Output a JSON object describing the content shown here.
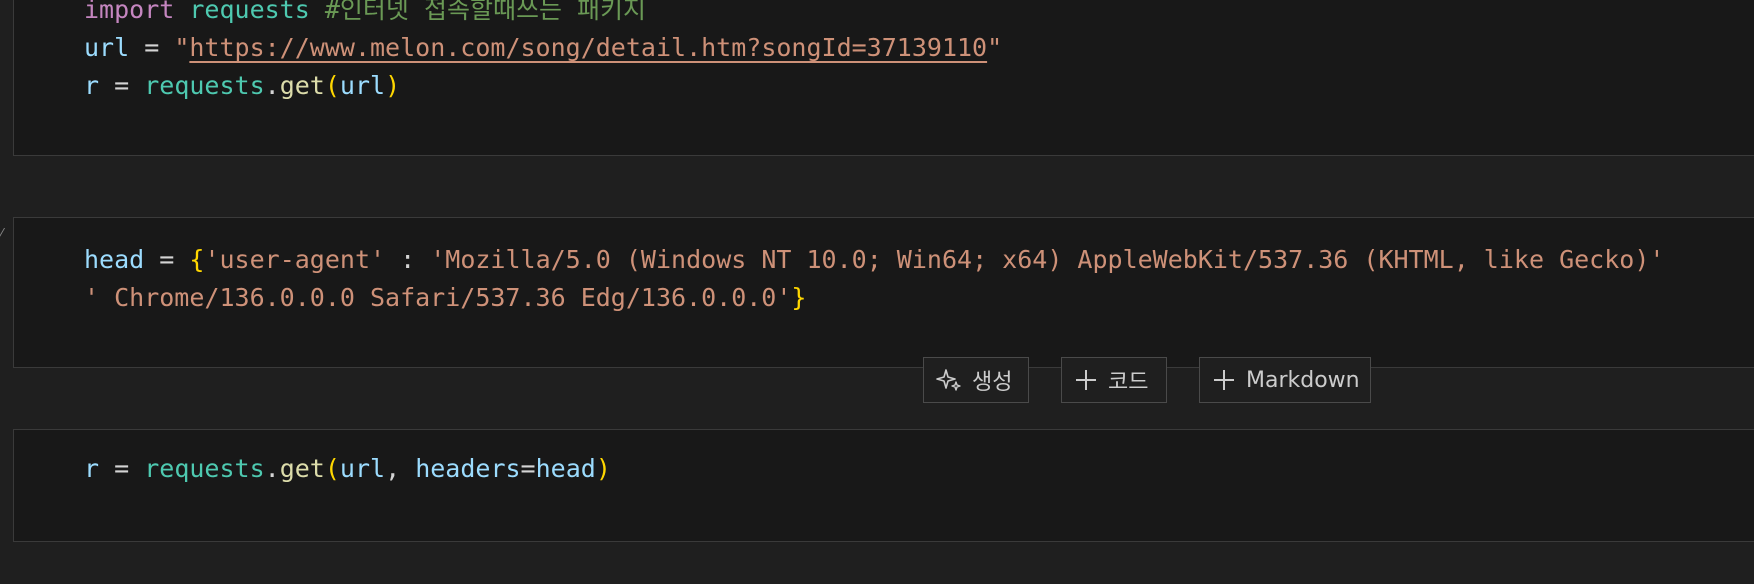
{
  "cells": [
    {
      "lines": [
        {
          "import_kw": "import",
          "module": "requests",
          "comment": "#인터넷 접속할때쓰는 패키지"
        },
        {
          "var": "url",
          "eq": " = ",
          "q_open": "\"",
          "url": "https://www.melon.com/song/detail.htm?songId=37139110",
          "q_close": "\""
        },
        {
          "var": "r",
          "eq": " = ",
          "module": "requests",
          "dot": ".",
          "fn": "get",
          "p_open": "(",
          "arg": "url",
          "p_close": ")"
        }
      ]
    },
    {
      "lines": [
        {
          "var": "head",
          "eq": " = ",
          "brace_open": "{",
          "key": "'user-agent'",
          "colon": " : ",
          "val": "'Mozilla/5.0 (Windows NT 10.0; Win64; x64) AppleWebKit/537.36 (KHTML, like Gecko)'"
        },
        {
          "val": "' Chrome/136.0.0.0 Safari/537.36 Edg/136.0.0.0'",
          "brace_close": "}"
        }
      ]
    },
    {
      "lines": [
        {
          "var": "r",
          "eq": " = ",
          "module": "requests",
          "dot": ".",
          "fn": "get",
          "p_open": "(",
          "arg1": "url",
          "comma": ", ",
          "kwarg": "headers",
          "kw_eq": "=",
          "kwval": "head",
          "p_close": ")"
        }
      ]
    }
  ],
  "toolbar": {
    "generate_label": "생성",
    "code_label": "코드",
    "markdown_label": "Markdown"
  },
  "icons": {
    "generate": "sparkle-icon",
    "add": "plus-icon"
  }
}
